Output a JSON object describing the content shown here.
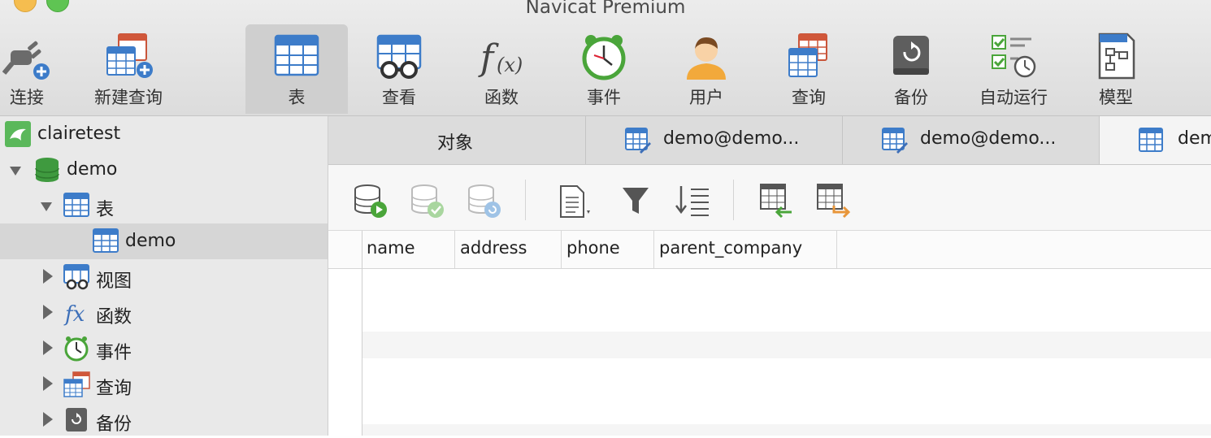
{
  "window": {
    "title": "Navicat Premium"
  },
  "toolbar": {
    "items": [
      {
        "label": "连接"
      },
      {
        "label": "新建查询"
      },
      {
        "label": "表"
      },
      {
        "label": "查看"
      },
      {
        "label": "函数"
      },
      {
        "label": "事件"
      },
      {
        "label": "用户"
      },
      {
        "label": "查询"
      },
      {
        "label": "备份"
      },
      {
        "label": "自动运行"
      },
      {
        "label": "模型"
      }
    ],
    "active_index": 2
  },
  "sidebar": {
    "connection": "clairetest",
    "database": "demo",
    "tables_label": "表",
    "table_item": "demo",
    "views_label": "视图",
    "functions_label": "函数",
    "events_label": "事件",
    "queries_label": "查询",
    "backups_label": "备份"
  },
  "tabs": [
    {
      "label": "对象"
    },
    {
      "label": "demo@demo..."
    },
    {
      "label": "demo@demo..."
    },
    {
      "label": "dem"
    }
  ],
  "grid": {
    "columns": [
      "name",
      "address",
      "phone",
      "parent_company"
    ]
  },
  "colors": {
    "accent_blue": "#3d7cc9",
    "toolbar_bg": "#e4e4e4",
    "sidebar_bg": "#e9e9e9"
  }
}
